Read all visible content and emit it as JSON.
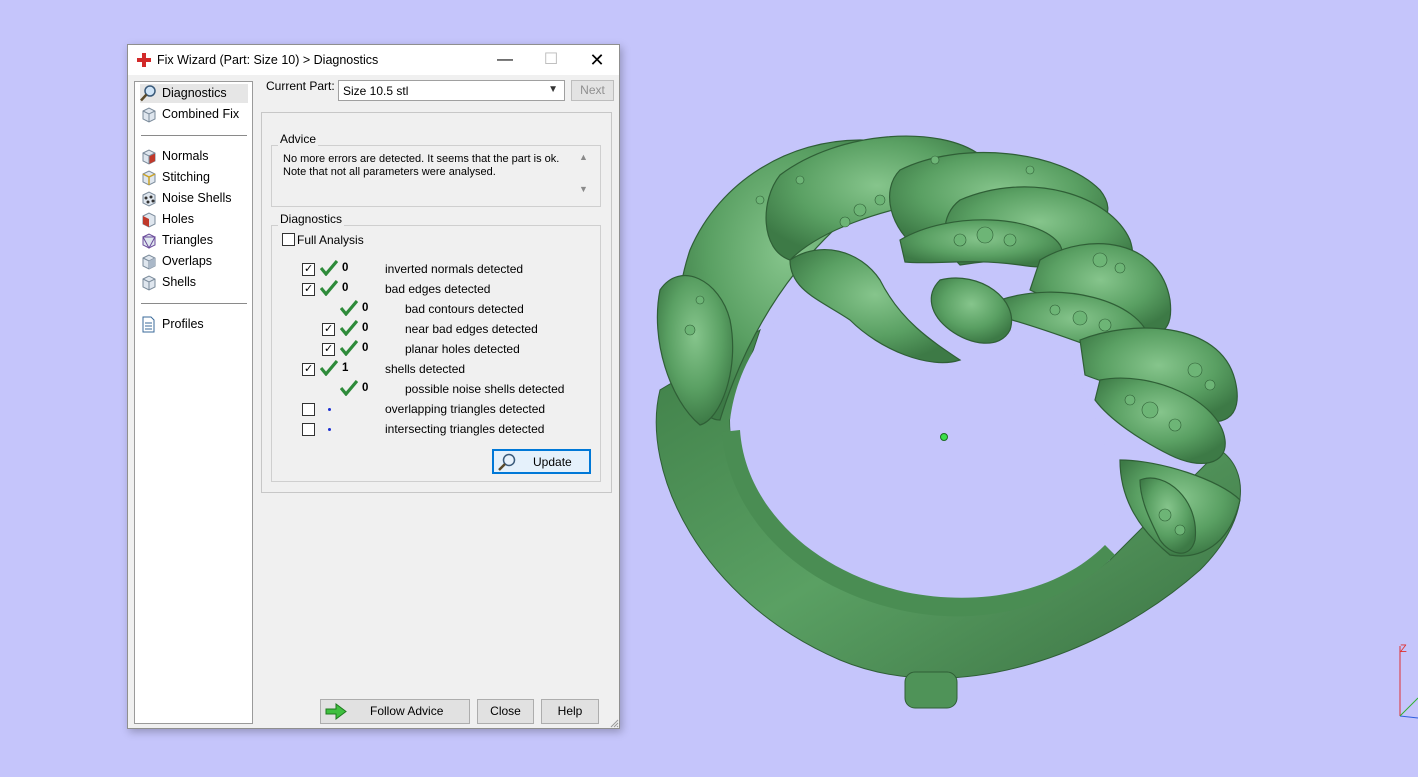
{
  "window": {
    "title": "Fix Wizard (Part: Size 10) > Diagnostics",
    "min_glyph": "—",
    "max_glyph": "☐",
    "close_glyph": "✕"
  },
  "sidebar": {
    "items": [
      {
        "label": "Diagnostics",
        "icon": "magnifier-icon",
        "selected": true
      },
      {
        "label": "Combined Fix",
        "icon": "cube-icon"
      },
      {
        "label": "Normals",
        "icon": "cube-red-icon"
      },
      {
        "label": "Stitching",
        "icon": "cube-stitch-icon"
      },
      {
        "label": "Noise Shells",
        "icon": "dots-cube-icon"
      },
      {
        "label": "Holes",
        "icon": "cube-hole-icon"
      },
      {
        "label": "Triangles",
        "icon": "triangle-cube-icon"
      },
      {
        "label": "Overlaps",
        "icon": "overlap-cube-icon"
      },
      {
        "label": "Shells",
        "icon": "shells-cube-icon"
      },
      {
        "label": "Profiles",
        "icon": "document-icon"
      }
    ]
  },
  "main": {
    "current_part_label": "Current Part:",
    "current_part_value": "Size 10.5 stl",
    "next_label": "Next",
    "advice_title": "Advice",
    "advice_lines": [
      "No more errors are detected. It seems that the part is ok.",
      "Note that not all parameters were analysed."
    ],
    "diagnostics_title": "Diagnostics",
    "full_analysis_label": "Full Analysis",
    "full_analysis_checked": false,
    "rows": [
      {
        "checkbox": true,
        "checked": true,
        "status": "ok",
        "count": "0",
        "label": "inverted normals detected",
        "indent": 0
      },
      {
        "checkbox": true,
        "checked": true,
        "status": "ok",
        "count": "0",
        "label": "bad edges detected",
        "indent": 0
      },
      {
        "checkbox": false,
        "status": "ok",
        "count": "0",
        "label": "bad contours detected",
        "indent": 1
      },
      {
        "checkbox": true,
        "checked": true,
        "status": "ok",
        "count": "0",
        "label": "near bad edges detected",
        "indent": 1
      },
      {
        "checkbox": true,
        "checked": true,
        "status": "ok",
        "count": "0",
        "label": "planar holes detected",
        "indent": 1
      },
      {
        "checkbox": true,
        "checked": true,
        "status": "ok",
        "count": "1",
        "label": "shells detected",
        "indent": 0
      },
      {
        "checkbox": false,
        "status": "ok",
        "count": "0",
        "label": "possible noise shells detected",
        "indent": 1
      },
      {
        "checkbox": true,
        "checked": false,
        "status": "pending",
        "count": "",
        "label": "overlapping triangles detected",
        "indent": 0
      },
      {
        "checkbox": true,
        "checked": false,
        "status": "pending",
        "count": "",
        "label": "intersecting triangles detected",
        "indent": 0
      }
    ],
    "update_label": "Update",
    "follow_advice_label": "Follow Advice",
    "close_label": "Close",
    "help_label": "Help"
  },
  "viewport": {
    "background": "#c5c5fb",
    "model_color": "#5aa063",
    "axis_label": "Z"
  },
  "colors": {
    "check_green": "#2e8b3a",
    "focus_blue": "#0078d7"
  }
}
